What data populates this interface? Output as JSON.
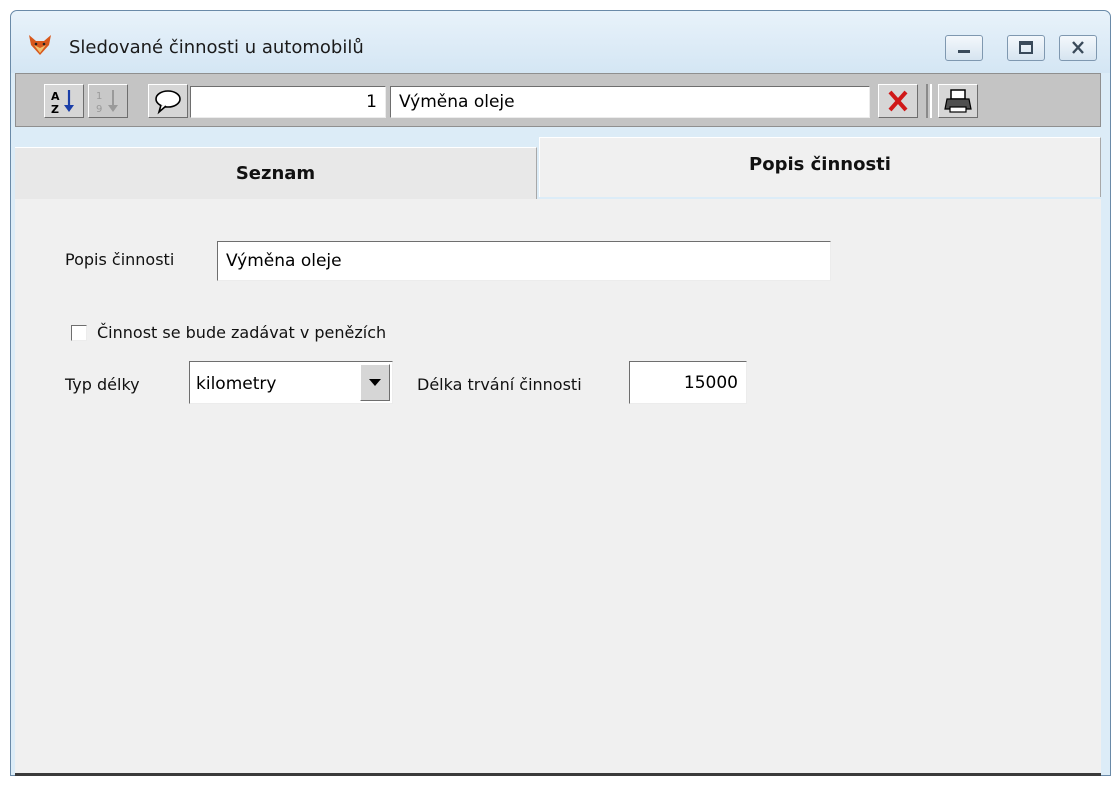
{
  "window": {
    "title": "Sledované činnosti u automobilů",
    "icon": "fox-icon"
  },
  "toolbar": {
    "sort_alpha_icon": "sort-az-icon",
    "sort_num_icon": "sort-19-icon",
    "comment_icon": "speech-bubble-icon",
    "record_number": "1",
    "record_name": "Výměna oleje",
    "delete_icon": "red-x-icon",
    "print_icon": "printer-icon"
  },
  "tabs": [
    {
      "label": "Seznam",
      "active": false
    },
    {
      "label": "Popis činnosti",
      "active": true
    }
  ],
  "form": {
    "popis_label": "Popis činnosti",
    "popis_value": "Výměna oleje",
    "checkbox_label": "Činnost se bude zadávat v penězích",
    "checkbox_checked": false,
    "typ_label": "Typ délky",
    "typ_value": "kilometry",
    "delka_label": "Délka trvání činnosti",
    "delka_value": "15000"
  },
  "colors": {
    "window_frame": "#dcecf7",
    "panel": "#f0f0f0",
    "toolbar": "#c4c4c4",
    "delete_red": "#d01818"
  }
}
